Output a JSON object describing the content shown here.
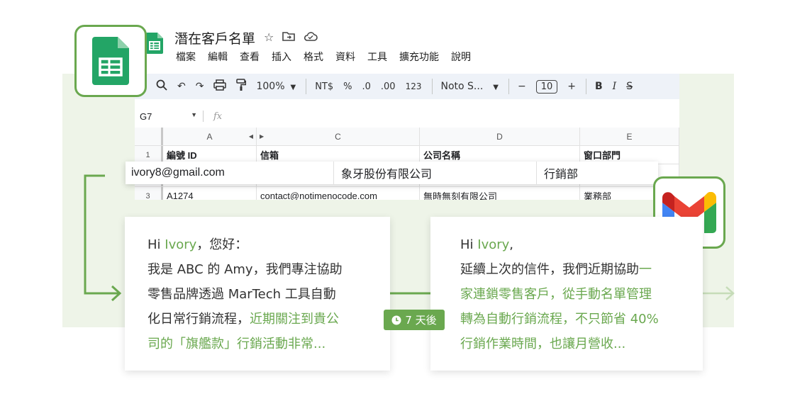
{
  "sheet": {
    "title": "潛在客戶名單",
    "menu": [
      "檔案",
      "編輯",
      "查看",
      "插入",
      "格式",
      "資料",
      "工具",
      "擴充功能",
      "說明"
    ],
    "toolbar": {
      "zoom": "100%",
      "currency": "NT$",
      "percent": "%",
      "dec_decrease": ".0",
      "dec_increase": ".00",
      "number_format": "123",
      "font": "Noto S...",
      "font_size": "10",
      "bold": "B",
      "italic": "I"
    },
    "cell_ref": "G7",
    "fx": "fx",
    "columns": [
      "A",
      "C",
      "D",
      "E"
    ],
    "rows": [
      {
        "num": "1",
        "cells": [
          "編號 ID",
          "信箱",
          "公司名稱",
          "窗口部門"
        ],
        "header": true
      },
      {
        "num": "3",
        "cells": [
          "A1274",
          "contact@notimenocode.com",
          "無時無刻有限公司",
          "業務部"
        ],
        "header": false
      }
    ]
  },
  "highlight_row": {
    "email": "ivory8@gmail.com",
    "company": "象牙股份有限公司",
    "department": "行銷部"
  },
  "card1": {
    "greet_hi": "Hi ",
    "greet_name": "Ivory",
    "greet_rest": "，您好：",
    "line1": "我是 ABC 的 Amy，我們專注協助",
    "line2": "零售品牌透過 MarTech 工具自動",
    "line3_plain": "化日常行銷流程，",
    "line3_green": "近期關注到貴公",
    "line4_green": "司的「旗艦款」行銷活動非常..."
  },
  "card2": {
    "greet_hi": "Hi ",
    "greet_name": "Ivory",
    "greet_rest": ",",
    "line1_plain": "延續上次的信件，我們近期協助",
    "line1_green": "一",
    "line2_green": "家連鎖零售客戶，從手動名單管理",
    "line3_green": "轉為自動行銷流程，不只節省 40%",
    "line4_green": "行銷作業時間，也讓月營收..."
  },
  "badge": {
    "label": "7 天後"
  },
  "icons": {
    "sheets": "google-sheets-icon",
    "gmail": "gmail-icon",
    "clock": "clock-icon"
  },
  "colors": {
    "accent_green": "#6aa84f",
    "band": "#eef4e8",
    "sheets_green": "#23a566"
  }
}
